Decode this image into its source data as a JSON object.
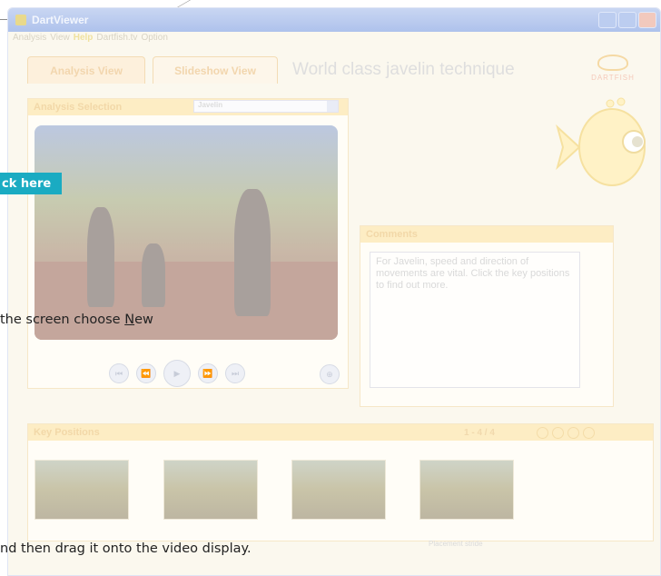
{
  "window": {
    "title": "DartViewer",
    "menu": [
      "Analysis",
      "View",
      "Help",
      "Dartfish.tv",
      "Option"
    ],
    "active_menu": 2
  },
  "tabs": [
    {
      "label": "Analysis View",
      "selected": true
    },
    {
      "label": "Slideshow View",
      "selected": false
    }
  ],
  "page_heading": "World class javelin technique",
  "logo_text": "DARTFISH",
  "analysis_panel": {
    "title": "Analysis Selection",
    "dropdown_value": "Javelin"
  },
  "transport_buttons": [
    "prev-icon",
    "rewind-icon",
    "play-icon",
    "forward-icon",
    "next-icon"
  ],
  "comments_panel": {
    "title": "Comments",
    "text": "For Javelin, speed and direction of movements are vital. Click the key positions to find out more."
  },
  "key_positions_panel": {
    "title": "Key Positions",
    "counter": "1 - 4 / 4",
    "thumbnails": [
      "Key position 1",
      "Key position 2",
      "Key position 3",
      "Key position 4"
    ],
    "caption": "Placement stride"
  },
  "overlay": {
    "callout": "ck here",
    "instruction_1_before": "the screen choose ",
    "instruction_1_u": "N",
    "instruction_1_after": "ew",
    "instruction_2": "nd then drag it onto the video display."
  },
  "colors": {
    "callout_bg": "#1aabc2",
    "panel_header": "#fdedc4",
    "title_bar": "#aec2ec"
  }
}
